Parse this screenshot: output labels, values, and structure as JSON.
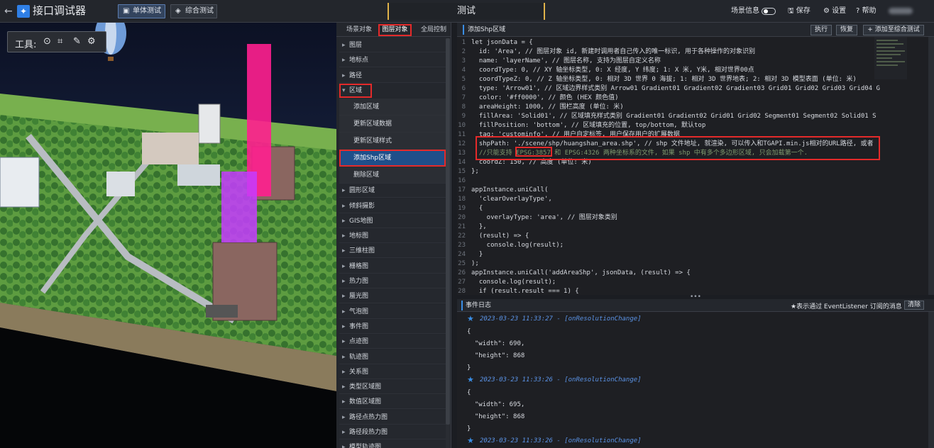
{
  "app": {
    "title": "接口调试器"
  },
  "top_buttons": {
    "unit_test": "单体测试",
    "combo_test": "综合测试"
  },
  "center": {
    "title": "测试"
  },
  "topright": {
    "scene_info": "场景信息",
    "save": "保存",
    "settings": "设置",
    "help": "帮助"
  },
  "toolbar": {
    "label": "工具:"
  },
  "tabs": {
    "scene_object": "场景对象",
    "layer_object": "图层对象",
    "global_control": "全局控制"
  },
  "menu": [
    {
      "label": "图层",
      "type": "cat"
    },
    {
      "label": "地标点",
      "type": "cat"
    },
    {
      "label": "路径",
      "type": "cat"
    },
    {
      "label": "区域",
      "type": "open"
    },
    {
      "label": "添加区域",
      "type": "sub"
    },
    {
      "label": "更新区域数据",
      "type": "sub"
    },
    {
      "label": "更新区域样式",
      "type": "sub"
    },
    {
      "label": "添加Shp区域",
      "type": "sel"
    },
    {
      "label": "删除区域",
      "type": "sub"
    },
    {
      "label": "圆形区域",
      "type": "cat"
    },
    {
      "label": "倾斜摄影",
      "type": "cat"
    },
    {
      "label": "GIS地图",
      "type": "cat"
    },
    {
      "label": "地标图",
      "type": "cat"
    },
    {
      "label": "三维柱图",
      "type": "cat"
    },
    {
      "label": "栅格图",
      "type": "cat"
    },
    {
      "label": "热力图",
      "type": "cat"
    },
    {
      "label": "蜃光图",
      "type": "cat"
    },
    {
      "label": "气泡图",
      "type": "cat"
    },
    {
      "label": "事件图",
      "type": "cat"
    },
    {
      "label": "点迹图",
      "type": "cat"
    },
    {
      "label": "轨迹图",
      "type": "cat"
    },
    {
      "label": "关系图",
      "type": "cat"
    },
    {
      "label": "类型区域图",
      "type": "cat"
    },
    {
      "label": "数值区域图",
      "type": "cat"
    },
    {
      "label": "路径点热力图",
      "type": "cat"
    },
    {
      "label": "路径段热力图",
      "type": "cat"
    },
    {
      "label": "模型轨迹图",
      "type": "cat"
    }
  ],
  "code_panel": {
    "title": "添加Shp区域",
    "exec": "执行",
    "reset": "恢复",
    "add": "添加至综合测试"
  },
  "code_lines": [
    {
      "n": "1",
      "t": "let jsonData = {"
    },
    {
      "n": "2",
      "t": "  id: 'Area', // 图层对象 id, 新建时调用者自己传入的唯一标识, 用于各种操作的对象识别"
    },
    {
      "n": "3",
      "t": "  name: 'layerName', // 图层名称, 支持为图层自定义名称"
    },
    {
      "n": "4",
      "t": "  coordType: 0, // XY 轴坐标类型, 0: X 经度, Y 纬度; 1: X 米, Y米, 相对世界00点"
    },
    {
      "n": "5",
      "t": "  coordTypeZ: 0, // Z 轴坐标类型, 0: 相对 3D 世界 0 海拔; 1: 相对 3D 世界地表; 2: 相对 3D 模型表面 (单位: 米)"
    },
    {
      "n": "6",
      "t": "  type: 'Arrow01', // 区域边界样式类别 Arrow01 Gradient01 Gradient02 Gradient03 Grid01 Grid02 Grid03 Grid04 G"
    },
    {
      "n": "7",
      "t": "  color: '#ff0000', // 颜色 (HEX 颜色值)"
    },
    {
      "n": "8",
      "t": "  areaHeight: 1000, // 围栏高度 (单位: 米)"
    },
    {
      "n": "9",
      "t": "  fillArea: 'Solid01', // 区域填充样式类别 Gradient01 Gradient02 Grid01 Grid02 Segment01 Segment02 Solid01 S"
    },
    {
      "n": "10",
      "t": "  fillPosition: 'bottom', // 区域填充的位置, top/bottom, 默认top"
    },
    {
      "n": "11",
      "t": "  tag: 'custominfo', // 用户自定标签, 用户保存用户的扩展数据"
    },
    {
      "n": "12",
      "t": "  shpPath: './scene/shp/huangshan_area.shp', // shp 文件地址, 就渲染, 可以传入和TGAPI.min.js相对的URL路径, 或者"
    },
    {
      "n": "13",
      "t": "  //只能支持 EPSG:3857 和 EPSG:4326 两种坐标系的文件, 如果 shp 中有多个多边形区域, 只会加载第一个."
    },
    {
      "n": "14",
      "t": "  coordZ: 150, // 高度 (单位: 米)"
    },
    {
      "n": "15",
      "t": "};"
    },
    {
      "n": "16",
      "t": ""
    },
    {
      "n": "17",
      "t": "appInstance.uniCall("
    },
    {
      "n": "18",
      "t": "  'clearOverlayType',"
    },
    {
      "n": "19",
      "t": "  {"
    },
    {
      "n": "20",
      "t": "    overlayType: 'area', // 图层对象类别"
    },
    {
      "n": "21",
      "t": "  },"
    },
    {
      "n": "22",
      "t": "  (result) => {"
    },
    {
      "n": "23",
      "t": "    console.log(result);"
    },
    {
      "n": "24",
      "t": "  }"
    },
    {
      "n": "25",
      "t": ");"
    },
    {
      "n": "26",
      "t": "appInstance.uniCall('addAreaShp', jsonData, (result) => {"
    },
    {
      "n": "27",
      "t": "  console.log(result);"
    },
    {
      "n": "28",
      "t": "  if (result.result === 1) {"
    }
  ],
  "log_panel": {
    "title": "事件日志",
    "note": "★表示通过 EventListener 订阅的消息",
    "clear": "清除"
  },
  "log_lines": [
    {
      "t": "2023-03-23 11:33:27 - [onResolutionChange]",
      "ev": true
    },
    {
      "t": "{",
      "ev": false
    },
    {
      "t": "  \"width\": 690,",
      "ev": false
    },
    {
      "t": "  \"height\": 868",
      "ev": false
    },
    {
      "t": "}",
      "ev": false
    },
    {
      "t": "2023-03-23 11:33:26 - [onResolutionChange]",
      "ev": true
    },
    {
      "t": "{",
      "ev": false
    },
    {
      "t": "  \"width\": 695,",
      "ev": false
    },
    {
      "t": "  \"height\": 868",
      "ev": false
    },
    {
      "t": "}",
      "ev": false
    },
    {
      "t": "2023-03-23 11:33:26 - [onResolutionChange]",
      "ev": true
    }
  ]
}
